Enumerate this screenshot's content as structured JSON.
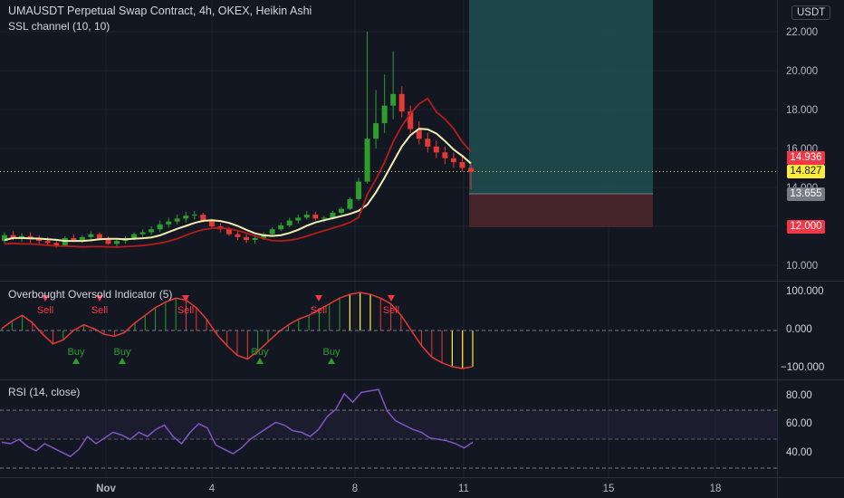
{
  "header": {
    "title": "UMAUSDT Perpetual Swap Contract, 4h, OKEX, Heikin Ashi",
    "indicator": "SSL channel (10, 10)",
    "currency_button": "USDT"
  },
  "price_axis": {
    "ticks": [
      "22.000",
      "20.000",
      "18.000",
      "16.000",
      "14.000",
      "12.000",
      "10.000"
    ],
    "badges": [
      {
        "label": "14.936",
        "bg": "#f23645",
        "fg": "#ffffff"
      },
      {
        "label": "14.827",
        "bg": "#ffeb3b",
        "fg": "#131722"
      },
      {
        "label": "13.655",
        "bg": "#787b86",
        "fg": "#ffffff"
      },
      {
        "label": "12.000",
        "bg": "#f23645",
        "fg": "#ffffff"
      }
    ]
  },
  "oscillator": {
    "title": "Overbought Oversold Indicator (5)",
    "ticks": [
      "100.000",
      "0.000",
      "−100.000"
    ],
    "sell_label": "Sell",
    "buy_label": "Buy"
  },
  "rsi": {
    "title": "RSI (14, close)",
    "ticks": [
      "80.00",
      "60.00",
      "40.00"
    ]
  },
  "time_axis": {
    "ticks": [
      "Nov",
      "4",
      "8",
      "11",
      "15",
      "18"
    ]
  },
  "colors": {
    "background": "#131722",
    "bull": "#26a69a",
    "bull_candle": "#2e9d2e",
    "bear_candle": "#e53935",
    "ssl_up": "#f2eeb0",
    "ssl_down": "#b71c1c",
    "rsi_line": "#7e57c2",
    "profit_zone": "#1e4f4f",
    "loss_zone": "#4a2629"
  },
  "chart_data": [
    {
      "type": "candlestick",
      "title": "UMAUSDT Perpetual Swap Contract, 4h, OKEX, Heikin Ashi",
      "x_ticks": [
        "Nov",
        "4",
        "8",
        "11",
        "15",
        "18"
      ],
      "ylim": [
        9,
        23
      ],
      "ohlc": [
        [
          11.25,
          11.7,
          11.1,
          11.55
        ],
        [
          11.55,
          11.75,
          11.3,
          11.4
        ],
        [
          11.4,
          11.65,
          11.2,
          11.5
        ],
        [
          11.5,
          11.7,
          11.15,
          11.35
        ],
        [
          11.35,
          11.55,
          11.1,
          11.25
        ],
        [
          11.25,
          11.45,
          11.0,
          11.15
        ],
        [
          11.15,
          11.35,
          10.9,
          11.0
        ],
        [
          11.0,
          11.5,
          10.95,
          11.4
        ],
        [
          11.4,
          11.6,
          11.2,
          11.3
        ],
        [
          11.3,
          11.55,
          11.15,
          11.45
        ],
        [
          11.45,
          11.75,
          11.3,
          11.6
        ],
        [
          11.6,
          11.7,
          11.3,
          11.35
        ],
        [
          11.35,
          11.5,
          11.05,
          11.1
        ],
        [
          11.1,
          11.35,
          10.95,
          11.25
        ],
        [
          11.25,
          11.5,
          11.1,
          11.4
        ],
        [
          11.4,
          11.7,
          11.3,
          11.6
        ],
        [
          11.6,
          11.85,
          11.45,
          11.7
        ],
        [
          11.7,
          12.0,
          11.55,
          11.85
        ],
        [
          11.85,
          12.3,
          11.7,
          12.1
        ],
        [
          12.1,
          12.45,
          11.95,
          12.25
        ],
        [
          12.25,
          12.6,
          12.1,
          12.4
        ],
        [
          12.4,
          12.75,
          12.2,
          12.55
        ],
        [
          12.55,
          12.8,
          12.35,
          12.6
        ],
        [
          12.6,
          12.7,
          12.2,
          12.3
        ],
        [
          12.3,
          12.4,
          11.9,
          12.0
        ],
        [
          12.0,
          12.15,
          11.7,
          11.85
        ],
        [
          11.85,
          11.95,
          11.5,
          11.6
        ],
        [
          11.6,
          11.75,
          11.3,
          11.45
        ],
        [
          11.45,
          11.6,
          11.15,
          11.3
        ],
        [
          11.3,
          11.5,
          11.1,
          11.4
        ],
        [
          11.4,
          11.7,
          11.3,
          11.6
        ],
        [
          11.6,
          11.95,
          11.5,
          11.85
        ],
        [
          11.85,
          12.2,
          11.75,
          12.05
        ],
        [
          12.05,
          12.45,
          11.95,
          12.3
        ],
        [
          12.3,
          12.6,
          12.15,
          12.45
        ],
        [
          12.45,
          12.8,
          12.35,
          12.6
        ],
        [
          12.6,
          12.75,
          12.3,
          12.4
        ],
        [
          12.4,
          12.55,
          12.2,
          12.45
        ],
        [
          12.45,
          12.8,
          12.35,
          12.7
        ],
        [
          12.7,
          13.0,
          12.6,
          12.9
        ],
        [
          12.9,
          13.5,
          12.85,
          13.4
        ],
        [
          13.4,
          14.5,
          13.3,
          14.3
        ],
        [
          14.3,
          22.0,
          14.2,
          16.5
        ],
        [
          16.5,
          19.0,
          16.0,
          17.3
        ],
        [
          17.3,
          19.8,
          16.8,
          18.2
        ],
        [
          18.2,
          21.0,
          17.5,
          18.8
        ],
        [
          18.8,
          19.2,
          17.6,
          17.9
        ],
        [
          17.9,
          18.2,
          16.8,
          17.0
        ],
        [
          17.0,
          17.4,
          16.2,
          16.5
        ],
        [
          16.5,
          16.8,
          15.8,
          16.1
        ],
        [
          16.1,
          16.4,
          15.5,
          15.8
        ],
        [
          15.8,
          16.1,
          15.2,
          15.5
        ],
        [
          15.5,
          15.8,
          15.0,
          15.3
        ],
        [
          15.3,
          15.6,
          14.8,
          15.0
        ],
        [
          15.0,
          15.2,
          13.9,
          14.8
        ]
      ]
    },
    {
      "type": "oscillator",
      "title": "Overbought Oversold Indicator (5)",
      "ylim": [
        -100,
        100
      ],
      "values": [
        5,
        25,
        40,
        20,
        -10,
        -35,
        -25,
        0,
        15,
        5,
        -10,
        -15,
        -5,
        20,
        40,
        60,
        75,
        85,
        80,
        60,
        30,
        -10,
        -40,
        -65,
        -75,
        -55,
        -30,
        -5,
        15,
        30,
        40,
        55,
        70,
        85,
        95,
        100,
        95,
        85,
        70,
        40,
        0,
        -40,
        -70,
        -85,
        -95,
        -100,
        -95
      ]
    },
    {
      "type": "line",
      "title": "RSI (14, close)",
      "ylim": [
        25,
        90
      ],
      "values": [
        48,
        47,
        50,
        45,
        42,
        47,
        44,
        41,
        38,
        43,
        52,
        47,
        51,
        55,
        53,
        50,
        55,
        52,
        57,
        60,
        52,
        47,
        55,
        61,
        58,
        46,
        43,
        40,
        44,
        50,
        54,
        58,
        62,
        60,
        56,
        55,
        52,
        57,
        66,
        71,
        82,
        76,
        83,
        84,
        85,
        70,
        63,
        60,
        57,
        55,
        51,
        50,
        49,
        47,
        44,
        48
      ]
    }
  ]
}
